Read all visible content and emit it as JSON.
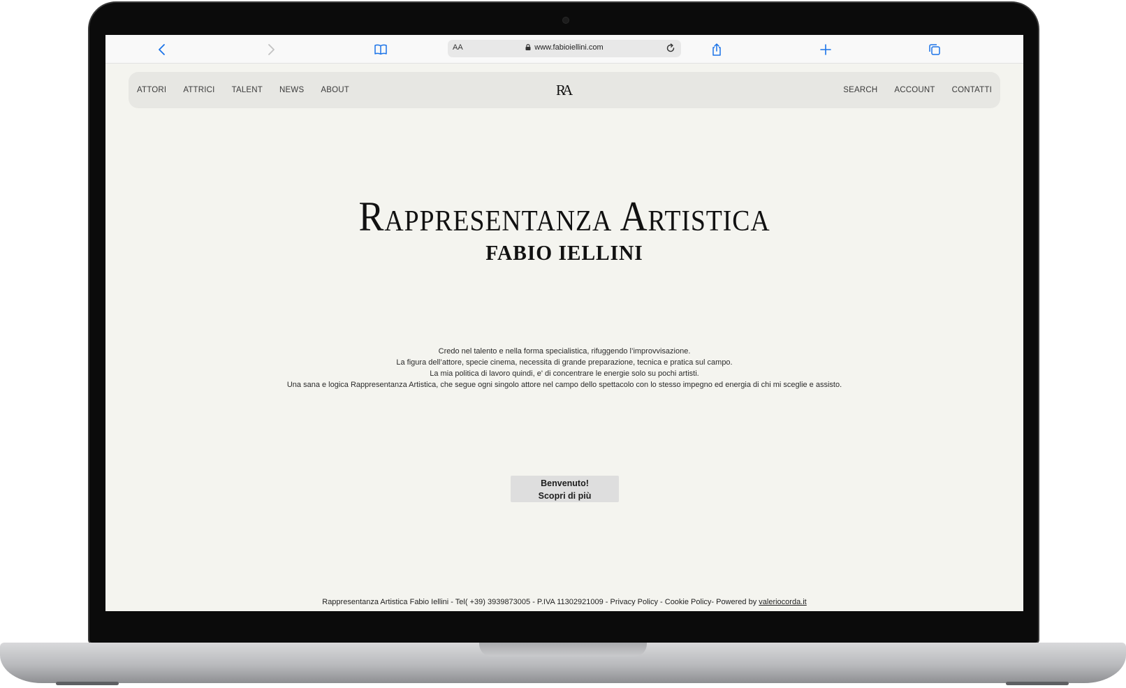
{
  "browser": {
    "aa_label": "AA",
    "url": "www.fabioiellini.com",
    "accent_color": "#1a73e8"
  },
  "nav": {
    "left_items": [
      "ATTORI",
      "ATTRICI",
      "TALENT",
      "NEWS",
      "ABOUT"
    ],
    "logo_text": "RA",
    "right_items": [
      "SEARCH",
      "ACCOUNT",
      "CONTATTI"
    ]
  },
  "hero": {
    "title": "Rappresentanza Artistica",
    "subtitle": "FABIO IELLINI"
  },
  "intro": {
    "lines": [
      "Credo nel talento e nella forma specialistica, rifuggendo l’improvvisazione.",
      "La figura dell’attore, specie cinema, necessita di grande preparazione, tecnica e pratica sul campo.",
      "La mia politica di lavoro quindi, e' di concentrare le energie solo su pochi artisti.",
      "Una sana e logica Rappresentanza Artistica, che segue ogni singolo attore nel campo dello spettacolo con lo stesso impegno ed energia di chi mi sceglie e assisto."
    ]
  },
  "cta": {
    "line1": "Benvenuto!",
    "line2": "Scopri di più"
  },
  "footer": {
    "text": "Rappresentanza Artistica Fabio Iellini - Tel( +39) 3939873005 - P.IVA 11302921009 - Privacy Policy - Cookie Policy- Powered by ",
    "link_text": "valeriocorda.it"
  }
}
